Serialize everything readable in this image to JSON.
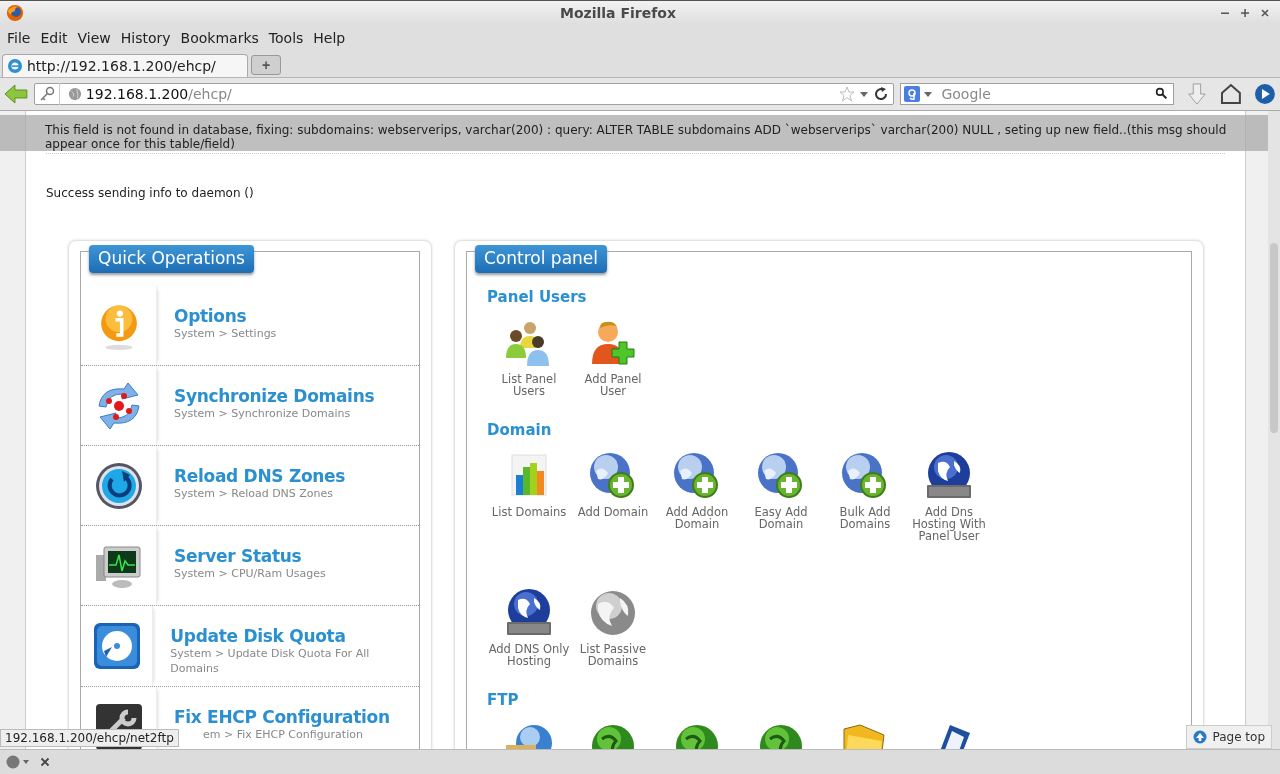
{
  "window": {
    "title": "Mozilla Firefox"
  },
  "menu": [
    "File",
    "Edit",
    "View",
    "History",
    "Bookmarks",
    "Tools",
    "Help"
  ],
  "tabs": [
    {
      "label": "http://192.168.1.200/ehcp/",
      "selected": true
    }
  ],
  "new_tab": "+",
  "address": {
    "host": "192.168.1.200",
    "path": "/ehcp/"
  },
  "search": {
    "placeholder": "Google"
  },
  "notice": "This field is not found in database, fixing: subdomains: webserverips, varchar(200) : query: ALTER TABLE subdomains ADD `webserverips` varchar(200) NULL , seting up new field..(this msg should appear once for this table/field)",
  "success_message": "Success sending info to daemon ()",
  "quick_operations": {
    "title": "Quick Operations",
    "items": [
      {
        "kind": "info",
        "title": "Options",
        "subtitle": "System > Settings"
      },
      {
        "kind": "sync",
        "title": "Synchronize Domains",
        "subtitle": "System > Synchronize Domains"
      },
      {
        "kind": "reload",
        "title": "Reload DNS Zones",
        "subtitle": "System > Reload DNS Zones"
      },
      {
        "kind": "monitor",
        "title": "Server Status",
        "subtitle": "System > CPU/Ram Usages"
      },
      {
        "kind": "disk",
        "title": "Update Disk Quota",
        "subtitle": "System > Update Disk Quota For All Domains"
      },
      {
        "kind": "tools",
        "title": "Fix EHCP Configuration",
        "subtitle": "em > Fix EHCP Configuration"
      }
    ]
  },
  "control_panel": {
    "title": "Control panel",
    "sections": [
      {
        "heading": "Panel Users",
        "items": [
          {
            "kind": "users",
            "label": "List Panel Users"
          },
          {
            "kind": "add-user",
            "label": "Add Panel User"
          }
        ]
      },
      {
        "heading": "Domain",
        "items": [
          {
            "kind": "chart",
            "label": "List Domains"
          },
          {
            "kind": "globe-add",
            "label": "Add Domain"
          },
          {
            "kind": "globe-add",
            "label": "Add Addon Domain"
          },
          {
            "kind": "globe-add",
            "label": "Easy Add Domain"
          },
          {
            "kind": "globe-add",
            "label": "Bulk Add Domains"
          },
          {
            "kind": "globe-dns",
            "label": "Add Dns Hosting With Panel User"
          },
          {
            "kind": "globe-dns",
            "label": "Add DNS Only Hosting"
          },
          {
            "kind": "globe-gray",
            "label": "List Passive Domains"
          }
        ]
      },
      {
        "heading": "FTP",
        "items": [
          {
            "kind": "ftp-folder"
          },
          {
            "kind": "globe-green"
          },
          {
            "kind": "globe-green"
          },
          {
            "kind": "globe-green"
          },
          {
            "kind": "folder"
          },
          {
            "kind": "blue-doc"
          }
        ]
      }
    ]
  },
  "status_link": "192.168.1.200/ehcp/net2ftp",
  "page_top": "Page top"
}
